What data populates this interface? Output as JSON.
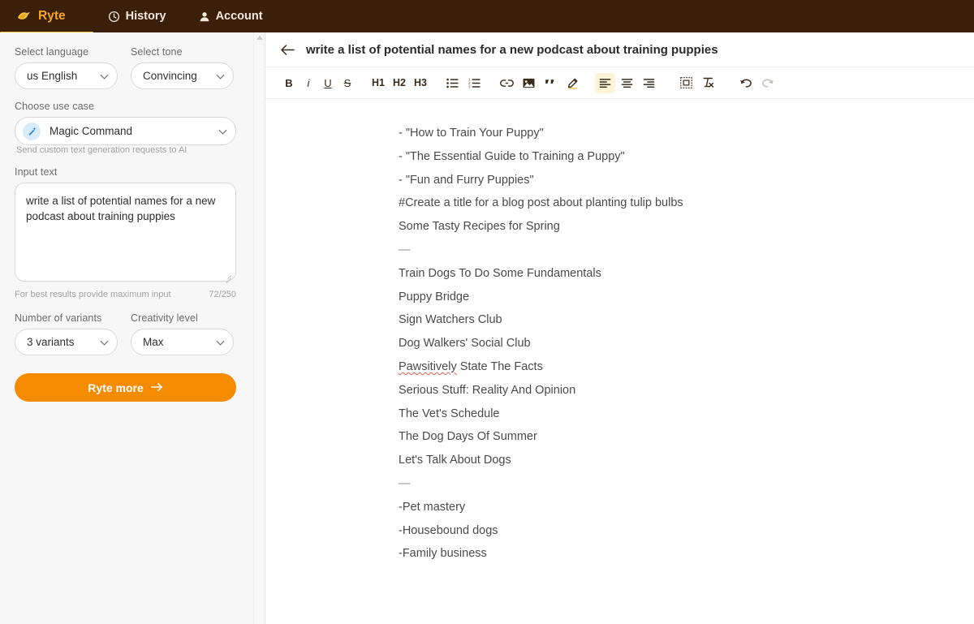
{
  "topnav": {
    "background": "#3a1f0b",
    "accent": "#f0c040",
    "items": [
      {
        "label": "Ryte",
        "icon": "ryte-logo-icon",
        "active": true
      },
      {
        "label": "History",
        "icon": "clock-history-icon",
        "active": false
      },
      {
        "label": "Account",
        "icon": "person-account-icon",
        "active": false
      }
    ]
  },
  "sidebar": {
    "language": {
      "label": "Select language",
      "value": "us English"
    },
    "tone": {
      "label": "Select tone",
      "value": "Convincing"
    },
    "use_case": {
      "label": "Choose use case",
      "value": "Magic Command",
      "icon": "magic-wand-icon",
      "helper": "Send custom text generation requests to AI"
    },
    "input": {
      "label": "Input text",
      "value": "write a list of potential names for a new podcast about training puppies",
      "placeholder": "",
      "hint": "For best results provide maximum input",
      "counter": "72/250"
    },
    "variants": {
      "label": "Number of variants",
      "value": "3 variants"
    },
    "creativity": {
      "label": "Creativity level",
      "value": "Max"
    },
    "submit": {
      "label": "Ryte more",
      "icon": "arrow-right-icon",
      "color": "#f58b00"
    }
  },
  "editor": {
    "back_icon": "back-arrow-icon",
    "title": "write a list of potential names for a new podcast about training puppies",
    "toolbar": [
      {
        "name": "bold",
        "label": "B",
        "kind": "txt",
        "active": false,
        "disabled": false
      },
      {
        "name": "italic",
        "label": "i",
        "kind": "txt-i",
        "active": false,
        "disabled": false
      },
      {
        "name": "underline",
        "label": "U",
        "kind": "txt-u",
        "active": false,
        "disabled": false
      },
      {
        "name": "strikethrough",
        "label": "S",
        "kind": "txt-s",
        "active": false,
        "disabled": false
      },
      {
        "name": "heading-1",
        "label": "H1",
        "kind": "heading",
        "active": false,
        "disabled": false
      },
      {
        "name": "heading-2",
        "label": "H2",
        "kind": "heading",
        "active": false,
        "disabled": false
      },
      {
        "name": "heading-3",
        "label": "H3",
        "kind": "heading",
        "active": false,
        "disabled": false
      },
      {
        "name": "bullet-list",
        "label": "",
        "kind": "icon",
        "active": false,
        "disabled": false
      },
      {
        "name": "numbered-list",
        "label": "",
        "kind": "icon",
        "active": false,
        "disabled": false
      },
      {
        "name": "link",
        "label": "",
        "kind": "icon",
        "active": false,
        "disabled": false
      },
      {
        "name": "image",
        "label": "",
        "kind": "icon",
        "active": false,
        "disabled": false
      },
      {
        "name": "blockquote",
        "label": "",
        "kind": "icon",
        "active": false,
        "disabled": false
      },
      {
        "name": "highlighter",
        "label": "",
        "kind": "icon",
        "active": false,
        "disabled": false
      },
      {
        "name": "align-left",
        "label": "",
        "kind": "icon",
        "active": true,
        "disabled": false
      },
      {
        "name": "align-center",
        "label": "",
        "kind": "icon",
        "active": false,
        "disabled": false
      },
      {
        "name": "align-right",
        "label": "",
        "kind": "icon",
        "active": false,
        "disabled": false
      },
      {
        "name": "insert-table",
        "label": "",
        "kind": "icon",
        "active": false,
        "disabled": false
      },
      {
        "name": "clear-formatting",
        "label": "",
        "kind": "icon",
        "active": false,
        "disabled": false
      },
      {
        "name": "undo",
        "label": "",
        "kind": "icon",
        "active": false,
        "disabled": false
      },
      {
        "name": "redo",
        "label": "",
        "kind": "icon",
        "active": false,
        "disabled": true
      }
    ],
    "document": [
      {
        "text": "- \"How to Train Your Puppy\""
      },
      {
        "text": "- \"The Essential Guide to Training a Puppy\""
      },
      {
        "text": "- \"Fun and Furry Puppies\""
      },
      {
        "text": "#Create a title for a blog post about planting tulip bulbs"
      },
      {
        "text": "Some Tasty Recipes for Spring"
      },
      {
        "text": "—",
        "rule": true
      },
      {
        "text": "Train Dogs To Do Some Fundamentals"
      },
      {
        "text": "Puppy Bridge"
      },
      {
        "text": "Sign Watchers Club"
      },
      {
        "text": "Dog Walkers' Social Club"
      },
      {
        "text": "Pawsitively State The Facts",
        "misspelled": "Pawsitively"
      },
      {
        "text": "Serious Stuff: Reality And Opinion"
      },
      {
        "text": "The Vet's Schedule"
      },
      {
        "text": "The Dog Days Of Summer"
      },
      {
        "text": "Let's Talk About Dogs"
      },
      {
        "text": "—",
        "rule": true
      },
      {
        "text": "-Pet mastery"
      },
      {
        "text": "-Housebound dogs"
      },
      {
        "text": "-Family business"
      }
    ]
  }
}
